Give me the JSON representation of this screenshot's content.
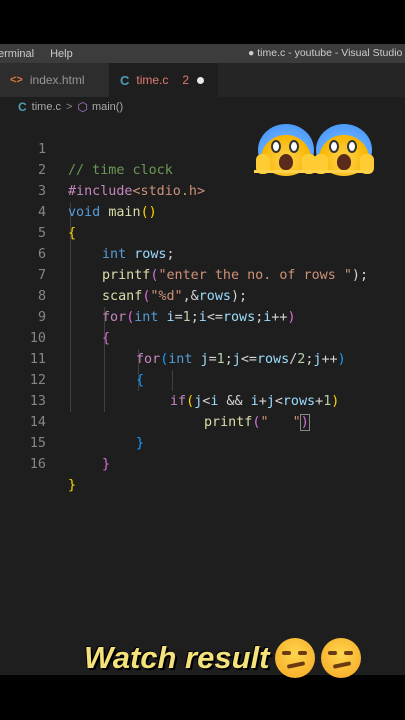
{
  "menubar": {
    "items": [
      "erminal",
      "Help"
    ],
    "window_title": "● time.c - youtube - Visual Studio"
  },
  "tabs": [
    {
      "label": "index.html",
      "icon": "html-icon"
    },
    {
      "label": "time.c",
      "icon": "c-icon",
      "badge": "2",
      "dirty": true
    }
  ],
  "breadcrumbs": {
    "file": "time.c",
    "symbol": "main()"
  },
  "code_lines": [
    {
      "n": "1"
    },
    {
      "n": "2"
    },
    {
      "n": "3"
    },
    {
      "n": "4"
    },
    {
      "n": "5"
    },
    {
      "n": "6"
    },
    {
      "n": "7"
    },
    {
      "n": "8"
    },
    {
      "n": "9"
    },
    {
      "n": "10"
    },
    {
      "n": "11"
    },
    {
      "n": "12"
    },
    {
      "n": "13"
    },
    {
      "n": "14"
    },
    {
      "n": "15"
    },
    {
      "n": "16"
    }
  ],
  "code": {
    "l1": "// time clock",
    "l2a": "#include",
    "l2b": "<stdio.h>",
    "l3a": "void",
    "l3b": "main",
    "l3c": "()",
    "l4": "{",
    "l5a": "int",
    "l5b": "rows",
    "l5c": ";",
    "l6a": "printf",
    "l6b": "(",
    "l6c": "\"enter the no. of rows \"",
    "l6d": ");",
    "l7a": "scanf",
    "l7b": "(",
    "l7c": "\"%d\"",
    "l7d": ",&",
    "l7e": "rows",
    "l7f": ");",
    "l8a": "for",
    "l8b": "(",
    "l8c": "int",
    "l8d": "i",
    "l8e": "=",
    "l8f": "1",
    "l8g": ";",
    "l8h": "i",
    "l8i": "<=",
    "l8j": "rows",
    "l8k": ";",
    "l8l": "i",
    "l8m": "++",
    "l8n": ")",
    "l9": "{",
    "l10a": "for",
    "l10b": "(",
    "l10c": "int",
    "l10d": "j",
    "l10e": "=",
    "l10f": "1",
    "l10g": ";",
    "l10h": "j",
    "l10i": "<=",
    "l10j": "rows",
    "l10k": "/",
    "l10l": "2",
    "l10m": ";",
    "l10n": "j",
    "l10o": "++",
    "l10p": ")",
    "l11": "{",
    "l12a": "if",
    "l12b": "(",
    "l12c": "j",
    "l12d": "<",
    "l12e": "i",
    "l12f": " && ",
    "l12g": "i",
    "l12h": "+",
    "l12i": "j",
    "l12j": "<",
    "l12k": "rows",
    "l12l": "+",
    "l12m": "1",
    "l12n": ")",
    "l13a": "printf",
    "l13b": "(",
    "l13c": "\"   \"",
    "l13d": ")",
    "l14": "}",
    "l15": "}",
    "l16": "}"
  },
  "caption": "Watch result",
  "colors": {
    "comment": "#6a9955",
    "keyword": "#569cd6",
    "control": "#c586c0",
    "function": "#dcdcaa",
    "string": "#ce9178",
    "variable": "#9cdcfe",
    "number": "#b5cea8",
    "caption": "#f5e27a"
  }
}
